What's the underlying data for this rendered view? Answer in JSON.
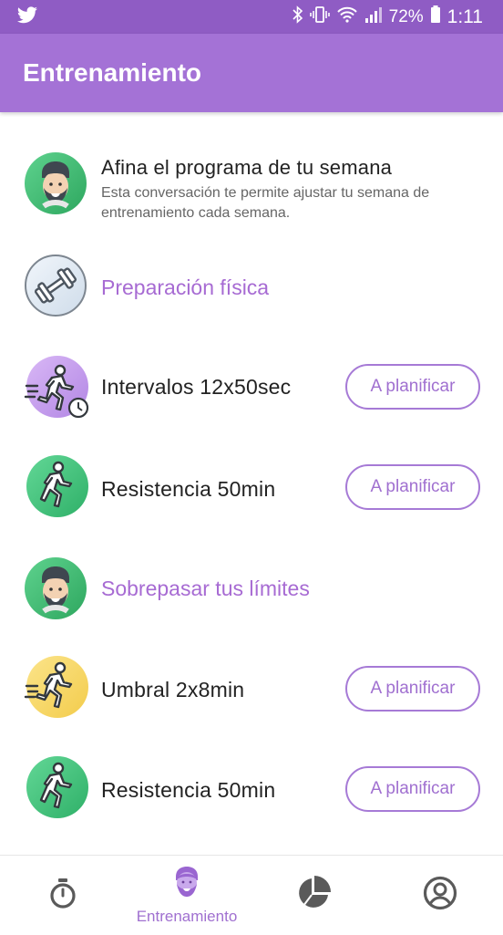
{
  "status": {
    "battery": "72%",
    "time": "1:11"
  },
  "header": {
    "title": "Entrenamiento"
  },
  "intro": {
    "title": "Afina el programa de tu semana",
    "subtitle": "Esta conversación te permite ajustar tu semana de entrenamiento cada semana."
  },
  "sections": [
    {
      "title": "Preparación física"
    },
    {
      "title": "Sobrepasar tus límites"
    }
  ],
  "sessions": [
    {
      "title": "Intervalos 12x50sec",
      "button": "A planificar",
      "icon": "interval-runner-icon",
      "color": "#c9a3ee"
    },
    {
      "title": "Resistencia 50min",
      "button": "A planificar",
      "icon": "runner-icon",
      "color": "#41c47a"
    },
    {
      "title": "Umbral 2x8min",
      "button": "A planificar",
      "icon": "runner-icon",
      "color": "#f6d565"
    },
    {
      "title": "Resistencia 50min",
      "button": "A planificar",
      "icon": "runner-icon",
      "color": "#41c47a"
    }
  ],
  "nav": {
    "items": [
      {
        "icon": "stopwatch-icon"
      },
      {
        "icon": "coach-icon",
        "label": "Entrenamiento",
        "active": true
      },
      {
        "icon": "pie-chart-icon"
      },
      {
        "icon": "profile-icon"
      }
    ]
  }
}
